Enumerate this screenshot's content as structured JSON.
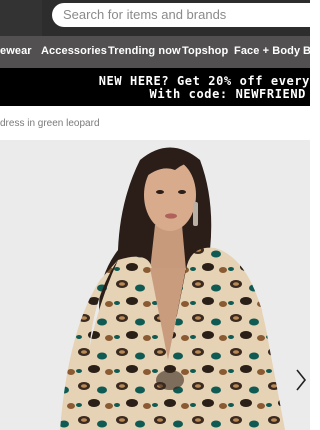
{
  "search": {
    "placeholder": "Search for items and brands"
  },
  "nav": {
    "items": [
      "ewear",
      "Accessories",
      "Trending now",
      "Topshop",
      "Face + Body",
      "B"
    ]
  },
  "promo": {
    "line1": "NEW HERE? Get 20% off every",
    "line2": "With code: NEWFRIEND"
  },
  "breadcrumb": {
    "text": "dress in green leopard"
  },
  "icons": {
    "next": "chevron-right-icon",
    "product": "product-photo"
  },
  "colors": {
    "topbar": "#2d2d2d",
    "nav": "#525050",
    "promo": "#000000",
    "photo_bg": "#ebebeb"
  }
}
